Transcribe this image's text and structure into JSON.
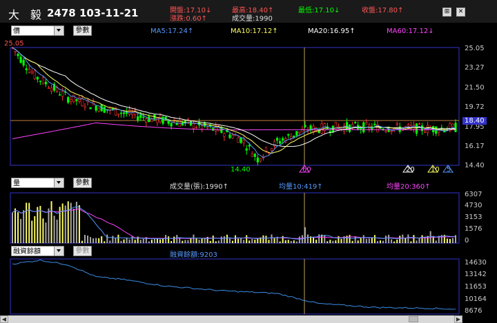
{
  "header": {
    "name": "大　毅",
    "code_date": "2478 103-11-21",
    "open": "開盤:17.10↓",
    "high": "最高:18.40↑",
    "low": "最低:17.10↓",
    "close": "收盤:17.80↑",
    "change": "漲跌:0.60↑",
    "volume": "成交量:1990"
  },
  "price_panel": {
    "selector": "價",
    "button": "參數",
    "ma5": "MA5:17.24↑",
    "ma10": "MA10:17.12↑",
    "ma20": "MA20:16.95↑",
    "ma60": "MA60:17.12↓",
    "y_ticks": [
      "25.05",
      "23.27",
      "21.50",
      "19.72",
      "17.95",
      "16.17",
      "14.40"
    ],
    "max_label": "25.05",
    "min_label": "14.40",
    "current_label": "18.40",
    "markers": [
      "60",
      "20",
      "10",
      "5"
    ]
  },
  "volume_panel": {
    "selector": "量",
    "button": "參數",
    "vol": "成交量(張):1990↑",
    "avg10": "均量10:419↑",
    "avg20": "均量20:360↑",
    "y_ticks": [
      "6307",
      "4730",
      "3153",
      "1576",
      "0"
    ]
  },
  "margin_panel": {
    "selector": "融資餘額",
    "button": "參數",
    "value": "融資餘額:9203",
    "y_ticks": [
      "14630",
      "13142",
      "11653",
      "10164",
      "8676"
    ]
  },
  "colors": {
    "up": "#ff3333",
    "down": "#00ff00",
    "ma5": "#5599ff",
    "ma10": "#ffff66",
    "ma20": "#ffffff",
    "ma60": "#ff44ff",
    "panel_border": "#3333cc",
    "margin_line": "#3a8ee6"
  }
}
